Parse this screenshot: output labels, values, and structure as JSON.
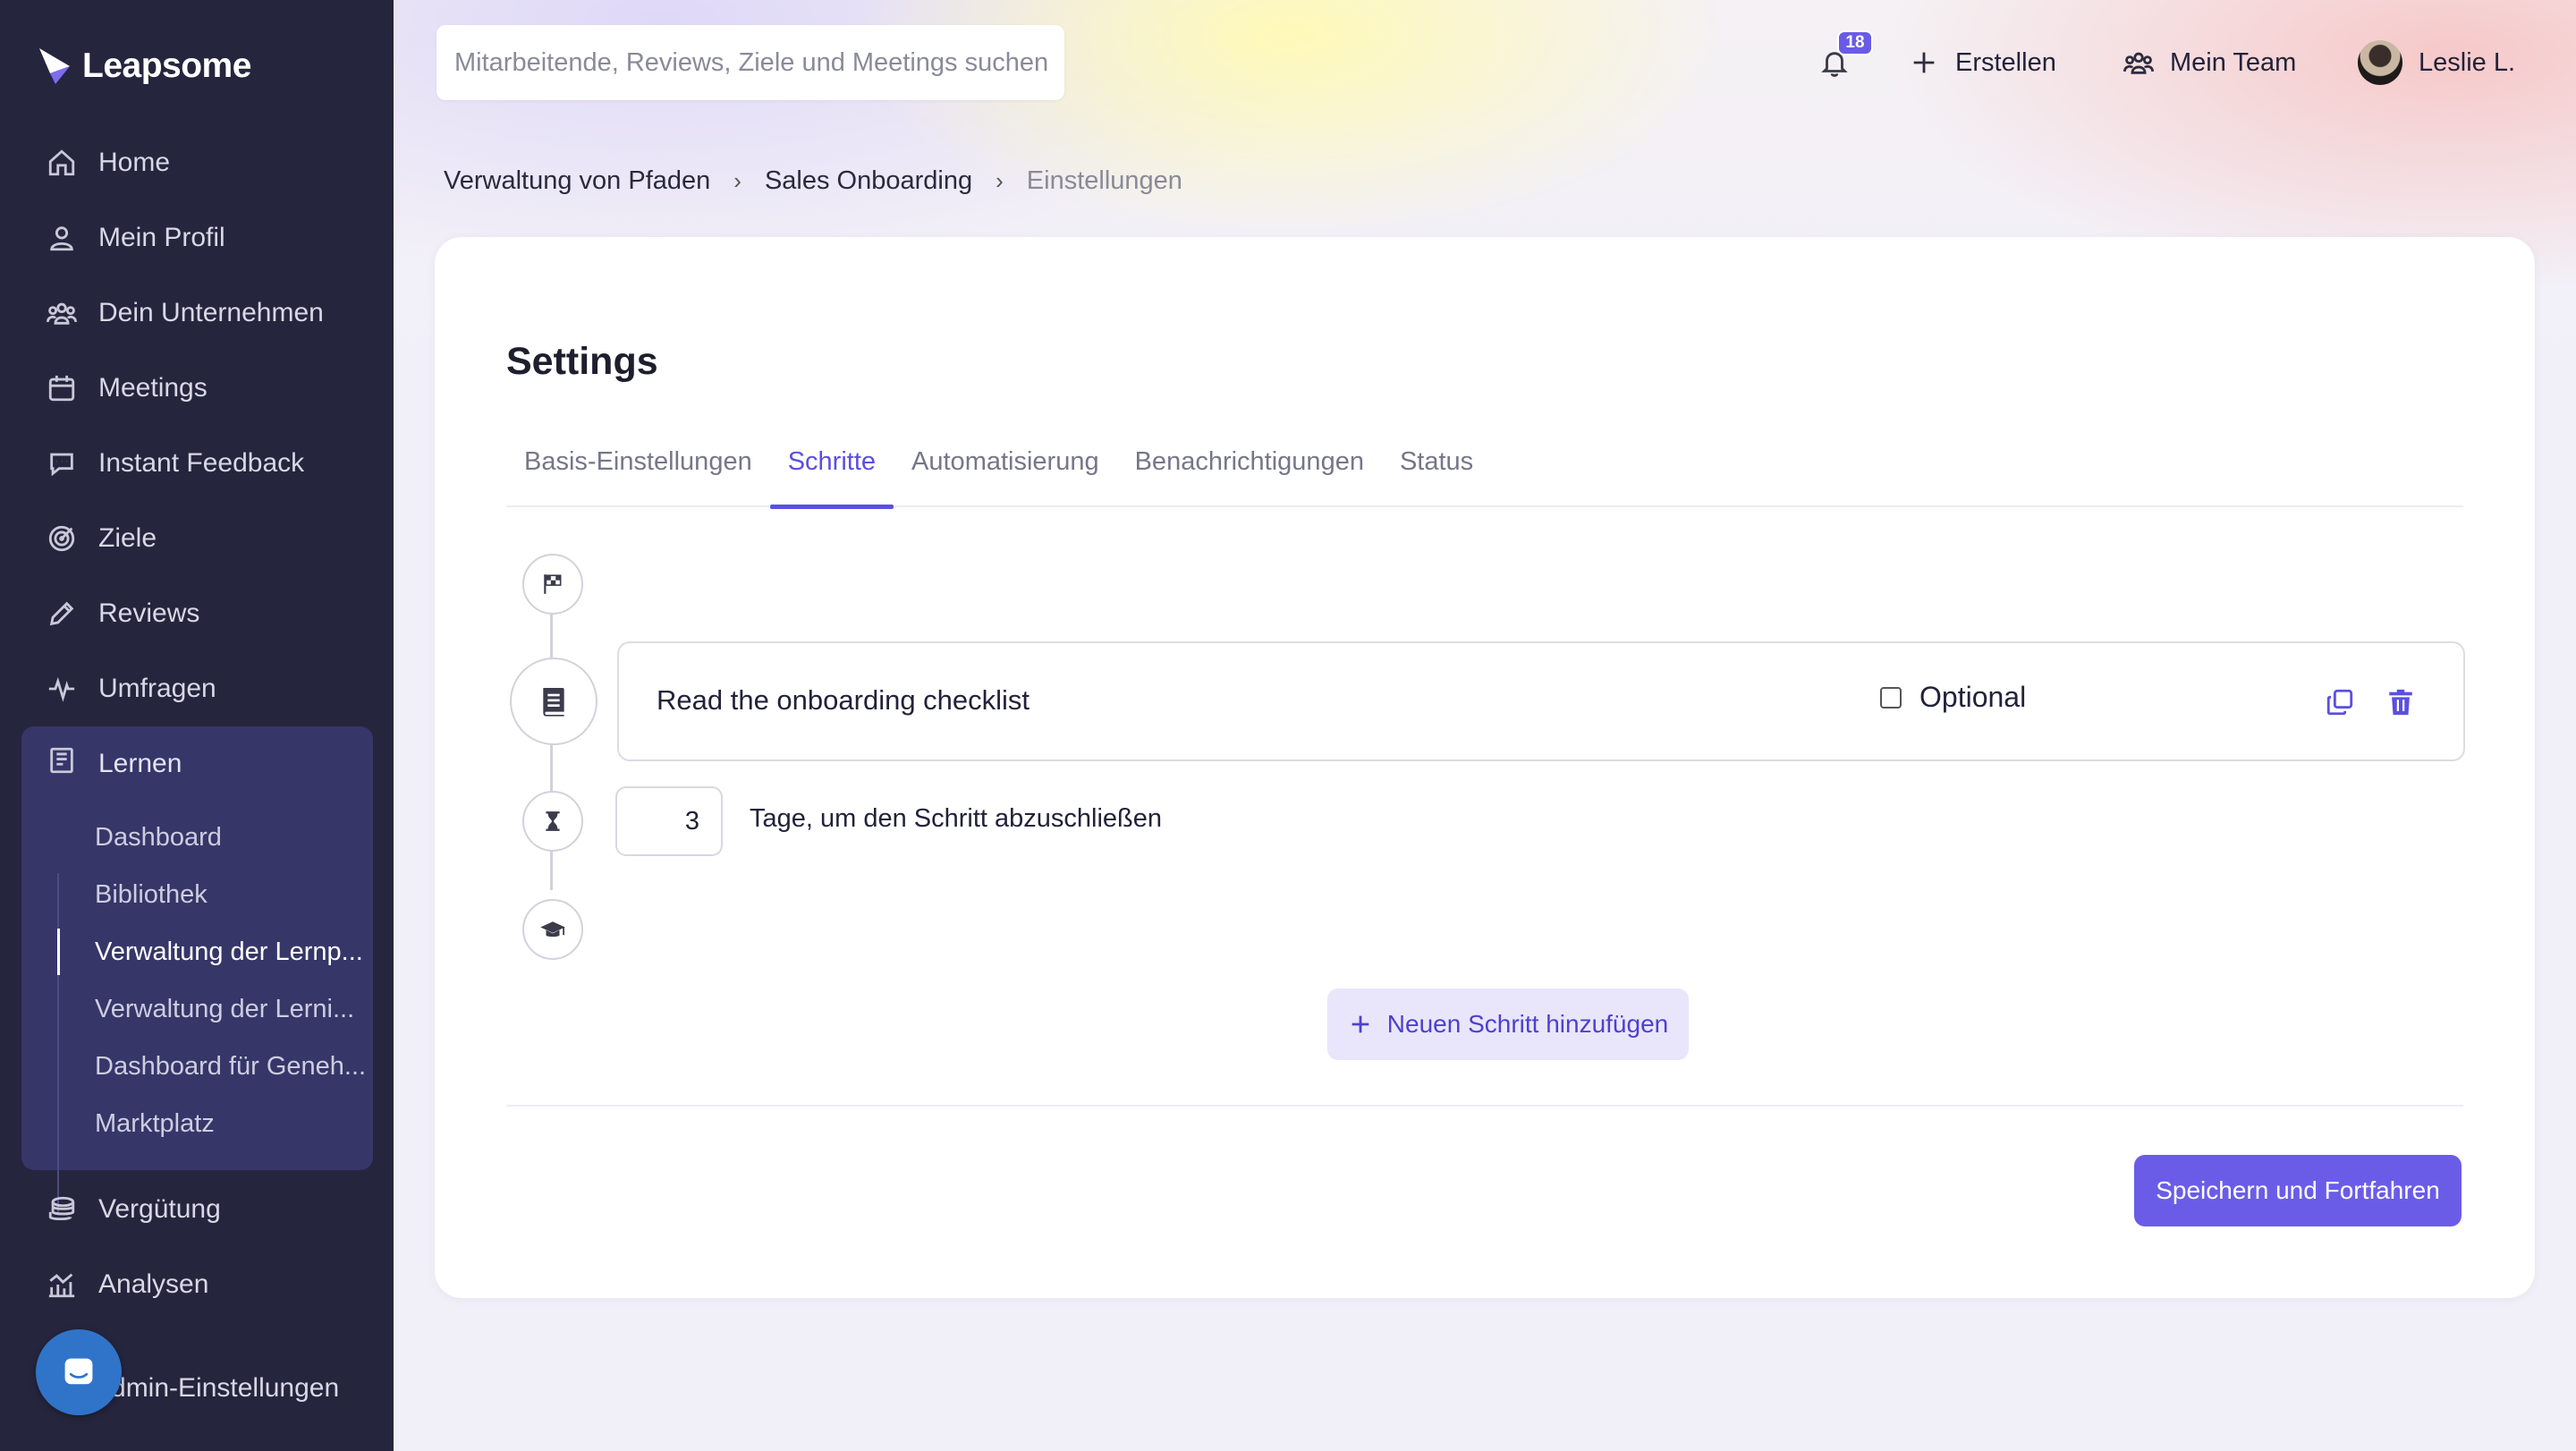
{
  "brand": {
    "name": "Leapsome"
  },
  "sidebar": {
    "items": [
      {
        "label": "Home",
        "icon": "home-icon"
      },
      {
        "label": "Mein Profil",
        "icon": "user-icon"
      },
      {
        "label": "Dein Unternehmen",
        "icon": "people-icon"
      },
      {
        "label": "Meetings",
        "icon": "calendar-icon"
      },
      {
        "label": "Instant Feedback",
        "icon": "chat-icon"
      },
      {
        "label": "Ziele",
        "icon": "target-icon"
      },
      {
        "label": "Reviews",
        "icon": "pencil-icon"
      },
      {
        "label": "Umfragen",
        "icon": "pulse-icon"
      }
    ],
    "learn": {
      "label": "Lernen",
      "sub_items": [
        {
          "label": "Dashboard"
        },
        {
          "label": "Bibliothek"
        },
        {
          "label": "Verwaltung der Lernp..."
        },
        {
          "label": "Verwaltung der Lerni..."
        },
        {
          "label": "Dashboard für Geneh..."
        },
        {
          "label": "Marktplatz"
        }
      ]
    },
    "bottom_items": [
      {
        "label": "Vergütung",
        "icon": "coins-icon"
      },
      {
        "label": "Analysen",
        "icon": "analytics-icon"
      }
    ],
    "admin_label": "Admin-Einstellungen"
  },
  "topbar": {
    "search_placeholder": "Mitarbeitende, Reviews, Ziele und Meetings suchen",
    "notification_count": "18",
    "create_label": "Erstellen",
    "team_label": "Mein Team",
    "user_name": "Leslie L."
  },
  "breadcrumb": {
    "items": [
      "Verwaltung von Pfaden",
      "Sales Onboarding"
    ],
    "current": "Einstellungen"
  },
  "settings": {
    "title": "Settings",
    "tabs": [
      {
        "label": "Basis-Einstellungen",
        "active": false
      },
      {
        "label": "Schritte",
        "active": true
      },
      {
        "label": "Automatisierung",
        "active": false
      },
      {
        "label": "Benachrichtigungen",
        "active": false
      },
      {
        "label": "Status",
        "active": false
      }
    ],
    "step": {
      "title": "Read the onboarding checklist",
      "optional_label": "Optional",
      "optional_checked": false
    },
    "days": {
      "value": "3",
      "label": "Tage, um den Schritt abzuschließen"
    },
    "add_step_label": "Neuen Schritt hinzufügen",
    "save_label": "Speichern und Fortfahren"
  },
  "colors": {
    "sidebar_bg": "#25253e",
    "sidebar_active_group": "#363669",
    "accent": "#6b5ce8",
    "accent_text": "#5b4fe0"
  }
}
